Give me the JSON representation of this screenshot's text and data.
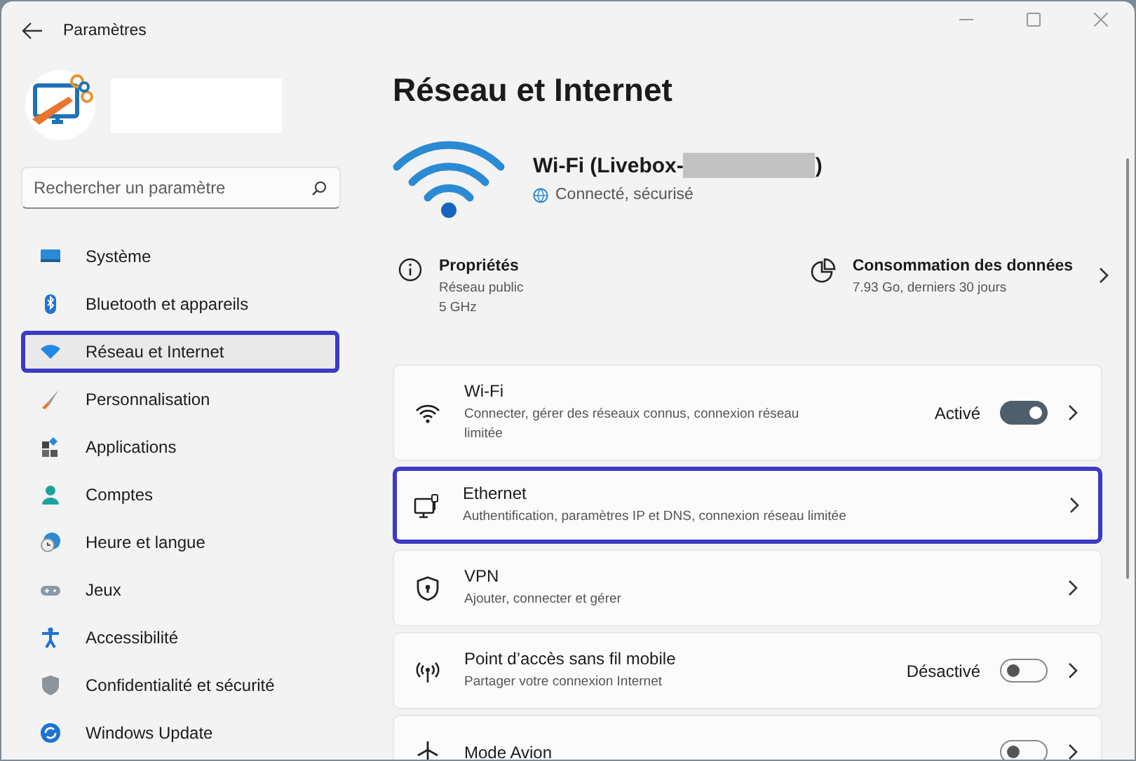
{
  "window": {
    "title": "Paramètres"
  },
  "search": {
    "placeholder": "Rechercher un paramètre"
  },
  "sidebar": {
    "items": [
      {
        "label": "Système",
        "selected": false
      },
      {
        "label": "Bluetooth et appareils",
        "selected": false
      },
      {
        "label": "Réseau et Internet",
        "selected": true
      },
      {
        "label": "Personnalisation",
        "selected": false
      },
      {
        "label": "Applications",
        "selected": false
      },
      {
        "label": "Comptes",
        "selected": false
      },
      {
        "label": "Heure et langue",
        "selected": false
      },
      {
        "label": "Jeux",
        "selected": false
      },
      {
        "label": "Accessibilité",
        "selected": false
      },
      {
        "label": "Confidentialité et sécurité",
        "selected": false
      },
      {
        "label": "Windows Update",
        "selected": false
      }
    ]
  },
  "page": {
    "title": "Réseau et Internet",
    "connection": {
      "name": "Wi-Fi (Livebox-",
      "name_end": ")",
      "status": "Connecté, sécurisé"
    },
    "properties": {
      "title": "Propriétés",
      "lines": [
        "Réseau public",
        "5 GHz"
      ]
    },
    "data_usage": {
      "title": "Consommation des données",
      "detail": "7.93 Go, derniers 30 jours"
    },
    "cards": [
      {
        "kind": "toggle",
        "title": "Wi-Fi",
        "subtitle": "Connecter, gérer des réseaux connus, connexion réseau limitée",
        "state": "Activé",
        "on": true,
        "highlighted": false
      },
      {
        "kind": "link",
        "title": "Ethernet",
        "subtitle": "Authentification, paramètres IP et DNS, connexion réseau limitée",
        "highlighted": true
      },
      {
        "kind": "link",
        "title": "VPN",
        "subtitle": "Ajouter, connecter et gérer",
        "highlighted": false
      },
      {
        "kind": "toggle",
        "title": "Point d’accès sans fil mobile",
        "subtitle": "Partager votre connexion Internet",
        "state": "Désactivé",
        "on": false,
        "highlighted": false
      },
      {
        "kind": "toggle",
        "title": "Mode Avion",
        "on": false,
        "highlighted": false
      }
    ]
  }
}
